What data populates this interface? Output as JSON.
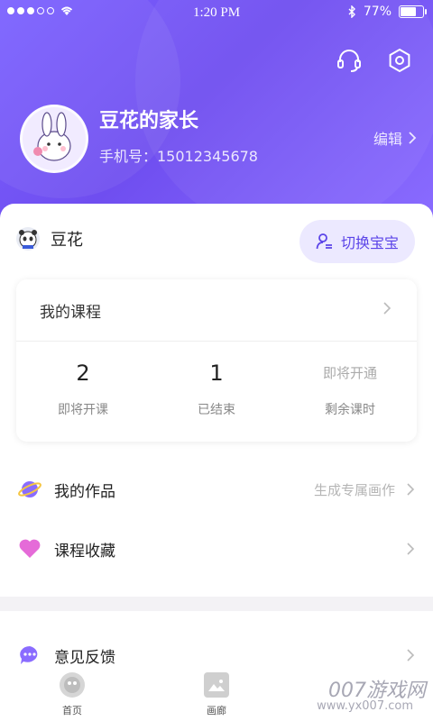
{
  "status": {
    "time": "1:20 PM",
    "battery_text": "77%",
    "battery_level": 0.77
  },
  "header": {
    "username": "豆花的家长",
    "phone": "手机号：15012345678",
    "edit_label": "编辑"
  },
  "baby": {
    "name": "豆花",
    "switch_label": "切换宝宝"
  },
  "course": {
    "title": "我的课程",
    "stats": [
      {
        "value": "2",
        "label": "即将开课"
      },
      {
        "value": "1",
        "label": "已结束"
      },
      {
        "value": "即将开通",
        "label": "剩余课时"
      }
    ]
  },
  "menu": [
    {
      "label": "我的作品",
      "hint": "生成专属画作",
      "icon": "planet-icon"
    },
    {
      "label": "课程收藏",
      "hint": "",
      "icon": "heart-icon"
    },
    {
      "label": "意见反馈",
      "hint": "",
      "icon": "chat-icon"
    }
  ],
  "tabbar": {
    "tabs": [
      {
        "label": "首页",
        "icon": "home-icon"
      },
      {
        "label": "画廊",
        "icon": "gallery-icon"
      }
    ]
  },
  "watermark": {
    "main": "007游戏网",
    "sub": "www.yx007.com"
  },
  "colors": {
    "accent": "#6f4ef0",
    "accent_light": "#ece9ff"
  }
}
